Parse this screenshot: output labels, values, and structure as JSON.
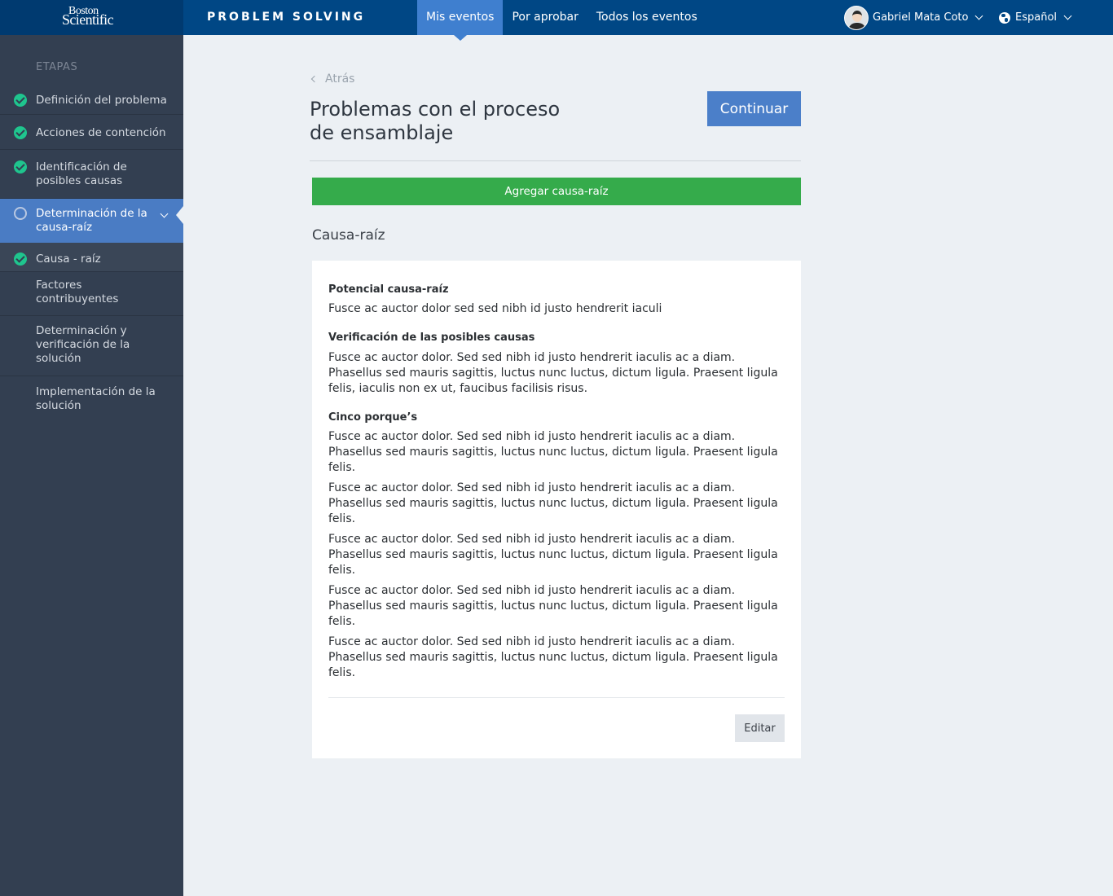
{
  "header": {
    "logo_line1": "Boston",
    "logo_line2": "Scientific",
    "app_title": "PROBLEM SOLVING",
    "nav": [
      {
        "label": "Mis eventos",
        "active": true
      },
      {
        "label": "Por aprobar",
        "active": false
      },
      {
        "label": "Todos los eventos",
        "active": false
      }
    ],
    "user_name": "Gabriel Mata Coto",
    "language": "Español"
  },
  "sidebar": {
    "heading": "ETAPAS",
    "steps": [
      {
        "label": "Definición del problema",
        "status": "done"
      },
      {
        "label": "Acciones de contención",
        "status": "done"
      },
      {
        "label": "Identificación de posibles causas",
        "status": "done"
      },
      {
        "label": "Determinación de la causa-raíz",
        "status": "current"
      },
      {
        "label": "Causa - raíz",
        "status": "done"
      },
      {
        "label": "Factores contribuyentes",
        "status": "pending"
      },
      {
        "label": "Determinación y verificación de la solución",
        "status": "pending"
      },
      {
        "label": "Implementación de la solución",
        "status": "pending"
      }
    ]
  },
  "main": {
    "back_label": "Atrás",
    "title": "Problemas con el proceso de ensamblaje",
    "continue_label": "Continuar",
    "add_label": "Agregar causa-raíz",
    "section_title": "Causa-raíz",
    "card": {
      "potential_label": "Potencial  causa-raíz",
      "potential_text": "Fusce ac auctor dolor sed sed nibh id justo hendrerit iaculi",
      "verification_label": "Verificación de las posibles causas",
      "verification_text": "Fusce ac auctor dolor. Sed sed nibh id justo hendrerit iaculis ac a diam. Phasellus sed mauris sagittis, luctus nunc luctus, dictum ligula. Praesent ligula felis, iaculis non ex ut, faucibus facilisis risus.",
      "five_whys_label": "Cinco porque’s",
      "five_whys": [
        "Fusce ac auctor dolor. Sed sed nibh id justo hendrerit iaculis ac a diam. Phasellus sed mauris sagittis, luctus nunc luctus, dictum ligula. Praesent ligula felis.",
        "Fusce ac auctor dolor. Sed sed nibh id justo hendrerit iaculis ac a diam. Phasellus sed mauris sagittis, luctus nunc luctus, dictum ligula. Praesent ligula felis.",
        "Fusce ac auctor dolor. Sed sed nibh id justo hendrerit iaculis ac a diam. Phasellus sed mauris sagittis, luctus nunc luctus, dictum ligula. Praesent ligula felis.",
        "Fusce ac auctor dolor. Sed sed nibh id justo hendrerit iaculis ac a diam. Phasellus sed mauris sagittis, luctus nunc luctus, dictum ligula. Praesent ligula felis.",
        "Fusce ac auctor dolor. Sed sed nibh id justo hendrerit iaculis ac a diam. Phasellus sed mauris sagittis, luctus nunc luctus, dictum ligula. Praesent ligula felis."
      ],
      "edit_label": "Editar"
    }
  },
  "colors": {
    "header_bg": "#004785",
    "nav_active": "#3f7fcf",
    "sidebar_bg": "#333f51",
    "sidebar_active": "#4a7cc4",
    "check": "#1fc58e",
    "primary_button": "#4b7fc9",
    "add_button": "#35ab4b"
  }
}
